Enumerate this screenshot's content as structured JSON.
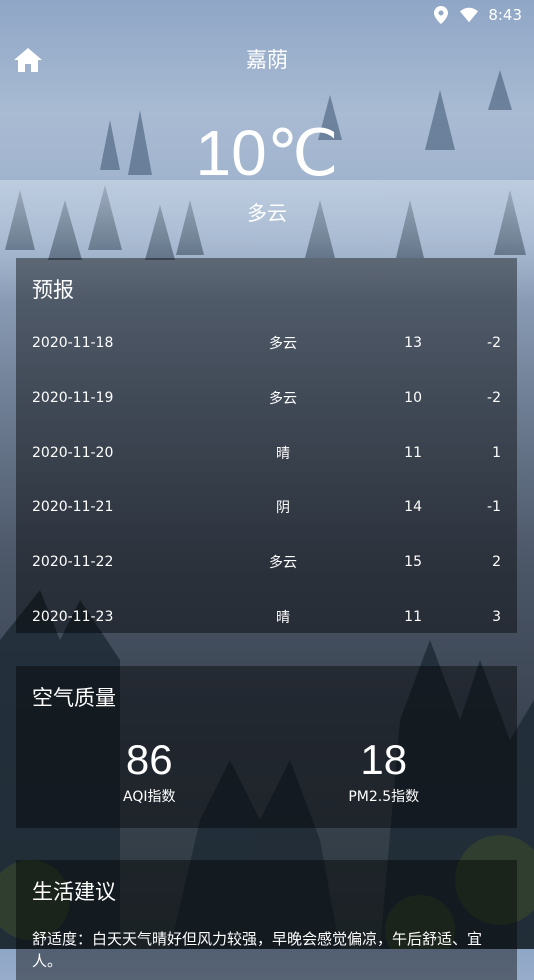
{
  "status_bar": {
    "time": "8:43",
    "icons": [
      "location-icon",
      "wifi-icon"
    ]
  },
  "header": {
    "city": "嘉荫",
    "home_icon": "home-icon"
  },
  "now": {
    "temperature": "10℃",
    "condition": "多云"
  },
  "forecast": {
    "title": "预报",
    "rows": [
      {
        "date": "2020-11-18",
        "condition": "多云",
        "max": "13",
        "min": "-2"
      },
      {
        "date": "2020-11-19",
        "condition": "多云",
        "max": "10",
        "min": "-2"
      },
      {
        "date": "2020-11-20",
        "condition": "晴",
        "max": "11",
        "min": "1"
      },
      {
        "date": "2020-11-21",
        "condition": "阴",
        "max": "14",
        "min": "-1"
      },
      {
        "date": "2020-11-22",
        "condition": "多云",
        "max": "15",
        "min": "2"
      },
      {
        "date": "2020-11-23",
        "condition": "晴",
        "max": "11",
        "min": "3"
      }
    ]
  },
  "air_quality": {
    "title": "空气质量",
    "aqi_value": "86",
    "aqi_label": "AQI指数",
    "pm25_value": "18",
    "pm25_label": "PM2.5指数"
  },
  "life": {
    "title": "生活建议",
    "comfort": "舒适度：白天天气晴好但风力较强，早晚会感觉偏凉，午后舒适、宜人。"
  },
  "colors": {
    "card_bg": "rgba(0,0,0,0.42)",
    "text": "#ffffff"
  }
}
